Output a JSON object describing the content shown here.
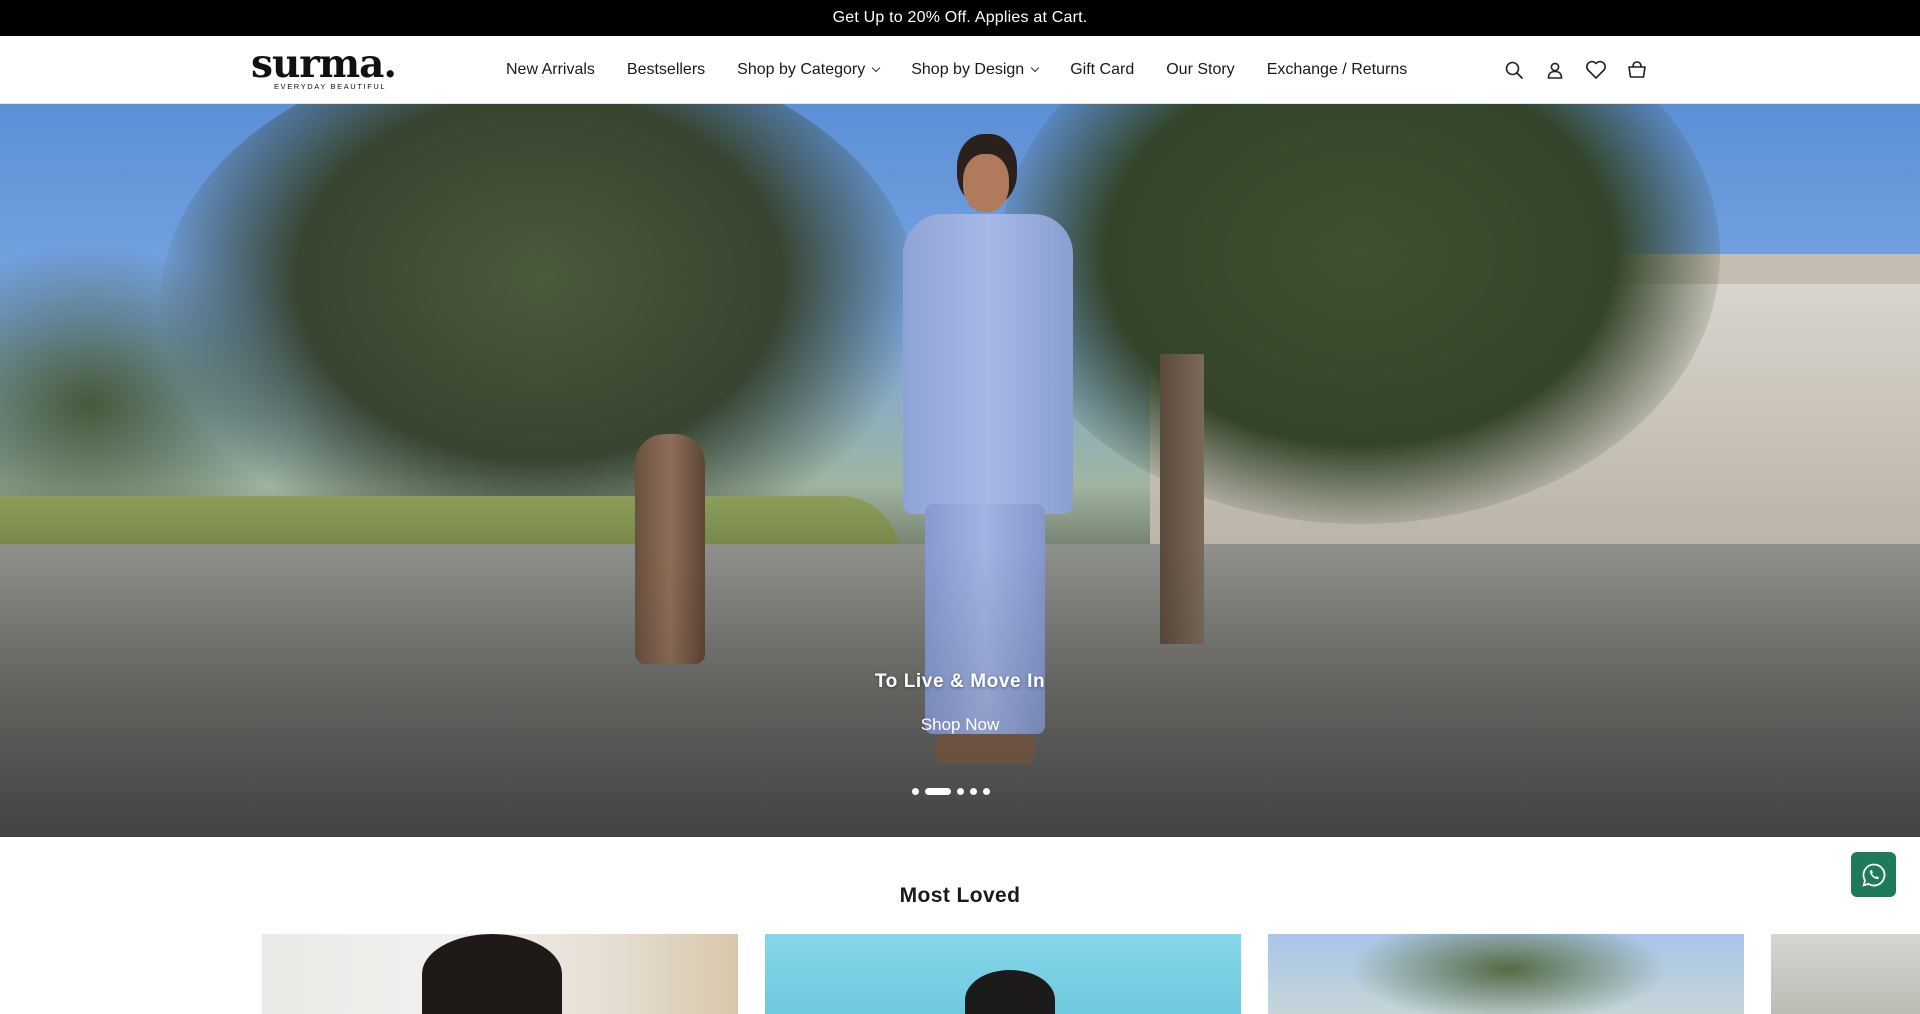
{
  "announcement": {
    "text": "Get Up to 20% Off. Applies at Cart."
  },
  "header": {
    "logo": {
      "word": "surma.",
      "tagline": "EVERYDAY BEAUTIFUL"
    },
    "nav": [
      {
        "label": "New Arrivals"
      },
      {
        "label": "Bestsellers"
      },
      {
        "label": "Shop by Category",
        "dropdown": true
      },
      {
        "label": "Shop by Design",
        "dropdown": true
      },
      {
        "label": "Gift Card"
      },
      {
        "label": "Our Story"
      },
      {
        "label": "Exchange / Returns"
      }
    ],
    "icons": [
      "search-icon",
      "account-icon",
      "wishlist-heart-icon",
      "cart-basket-icon"
    ]
  },
  "hero": {
    "title": "To Live & Move In",
    "cta": "Shop Now",
    "slide_count": 5,
    "active_slide": 2
  },
  "most_loved": {
    "title": "Most Loved"
  },
  "colors": {
    "announcement_bg": "#000000",
    "whatsapp": "#1f7a5a",
    "text": "#1a1a1a"
  }
}
